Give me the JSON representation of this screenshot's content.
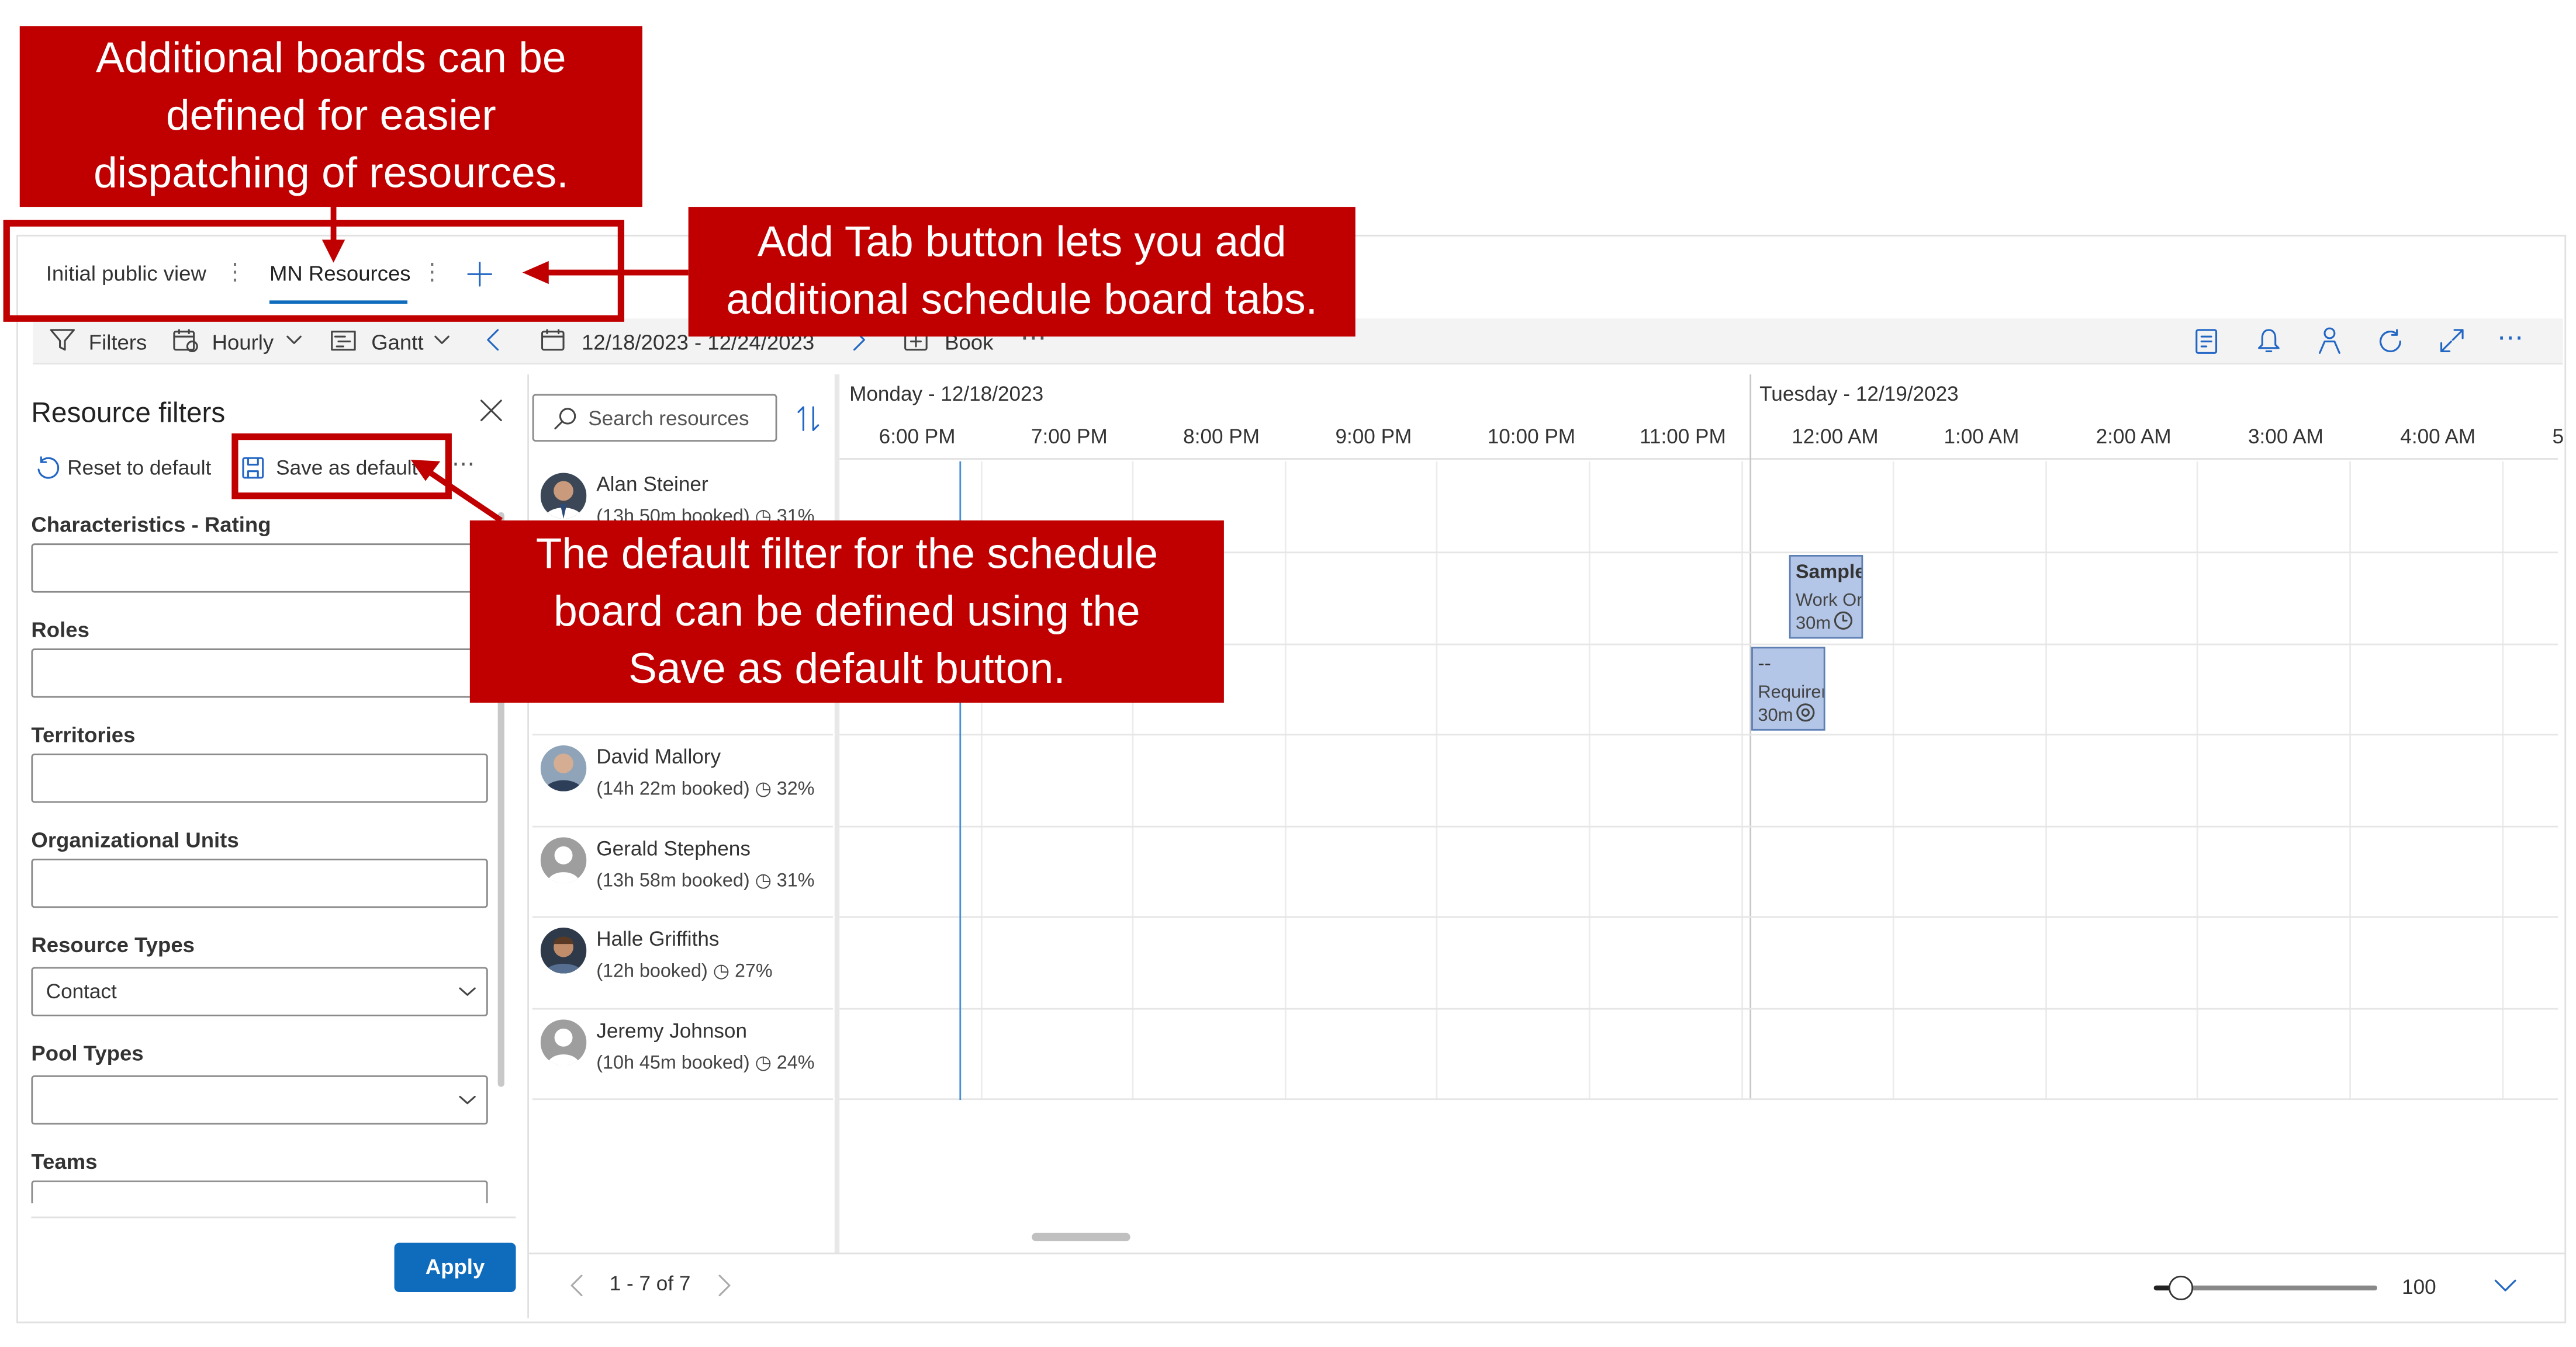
{
  "tabs": [
    {
      "label": "Initial public view"
    },
    {
      "label": "MN Resources"
    }
  ],
  "toolbar": {
    "filters": "Filters",
    "hourly": "Hourly",
    "gantt": "Gantt",
    "date_range": "12/18/2023 - 12/24/2023",
    "book": "Book",
    "more": "⋯"
  },
  "filter_panel": {
    "title": "Resource filters",
    "reset": "Reset to default",
    "save": "Save as default",
    "fields": [
      {
        "label": "Characteristics - Rating",
        "value": ""
      },
      {
        "label": "Roles",
        "value": ""
      },
      {
        "label": "Territories",
        "value": ""
      },
      {
        "label": "Organizational Units",
        "value": ""
      },
      {
        "label": "Resource Types",
        "value": "Contact"
      },
      {
        "label": "Pool Types",
        "value": ""
      },
      {
        "label": "Teams",
        "value": ""
      }
    ],
    "apply": "Apply"
  },
  "search": {
    "placeholder": "Search resources"
  },
  "resources": [
    {
      "name": "Alan Steiner",
      "booked": "(13h 50m booked)",
      "util": "31%"
    },
    {
      "name": "David Mallory",
      "booked": "(14h 22m booked)",
      "util": "32%"
    },
    {
      "name": "Gerald Stephens",
      "booked": "(13h 58m booked)",
      "util": "31%"
    },
    {
      "name": "Halle Griffiths",
      "booked": "(12h booked)",
      "util": "27%"
    },
    {
      "name": "Jeremy Johnson",
      "booked": "(10h 45m booked)",
      "util": "24%"
    }
  ],
  "days": [
    {
      "label": "Monday - 12/18/2023"
    },
    {
      "label": "Tuesday - 12/19/2023"
    }
  ],
  "hours": [
    "6:00 PM",
    "7:00 PM",
    "8:00 PM",
    "9:00 PM",
    "10:00 PM",
    "11:00 PM",
    "12:00 AM",
    "1:00 AM",
    "2:00 AM",
    "3:00 AM",
    "4:00 AM",
    "5"
  ],
  "bookings": [
    {
      "title": "Sample",
      "sub": "Work Or",
      "dur": "30m"
    },
    {
      "title": "--",
      "sub": "Requirem",
      "dur": "30m"
    }
  ],
  "pagination": {
    "label": "1 - 7 of 7"
  },
  "zoom": {
    "value": "100",
    "level": 0.12
  },
  "callouts": {
    "tabs": "Additional boards can be defined for easier dispatching of resources.",
    "tabs_l1": "Additional boards can be",
    "tabs_l2": "defined for easier",
    "tabs_l3": "dispatching of resources.",
    "addtab_l1": "Add Tab button lets you add",
    "addtab_l2": "additional schedule board tabs.",
    "default_l1": "The default filter for the schedule",
    "default_l2": "board can be defined using the",
    "default_l3": "Save as default button."
  },
  "colors": {
    "accent": "#0f6cbd",
    "callout": "#c00000",
    "booking": "#b4c6e7"
  }
}
